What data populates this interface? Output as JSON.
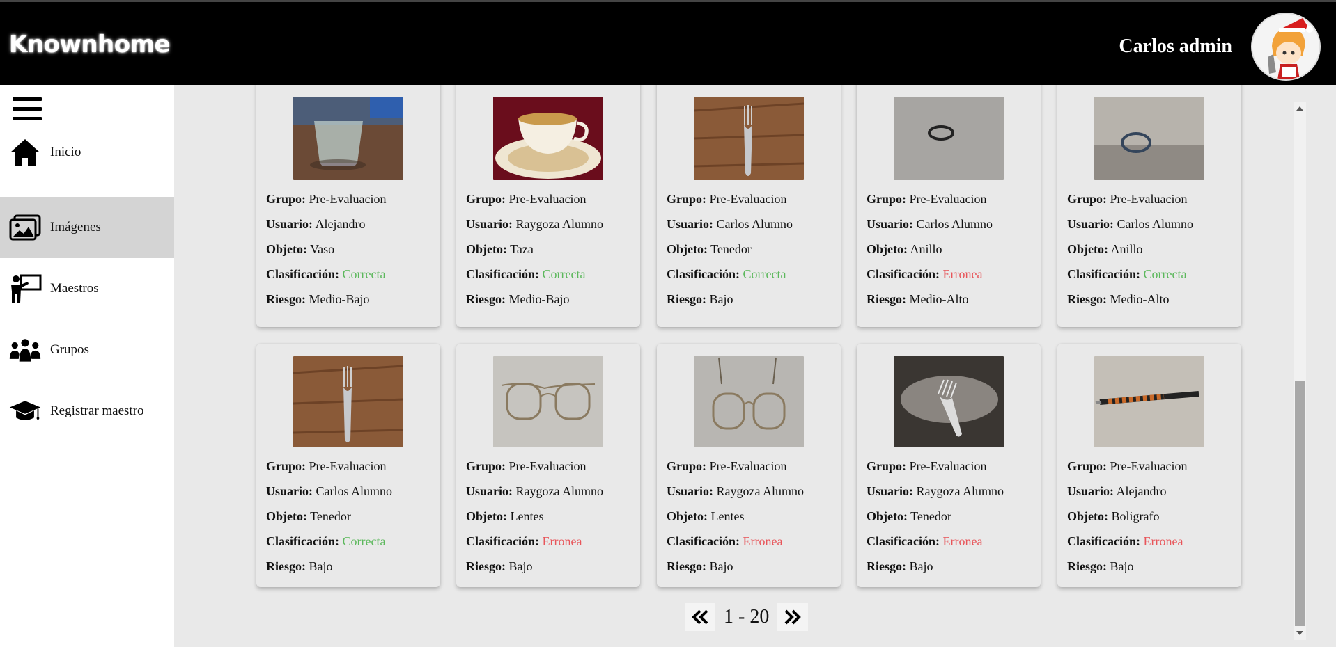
{
  "header": {
    "brand": "Knownhome",
    "user_name": "Carlos admin"
  },
  "sidebar": {
    "items": [
      {
        "label": "Inicio",
        "icon": "home-icon",
        "active": false
      },
      {
        "label": "Imágenes",
        "icon": "images-icon",
        "active": true
      },
      {
        "label": "Maestros",
        "icon": "teacher-icon",
        "active": false
      },
      {
        "label": "Grupos",
        "icon": "group-icon",
        "active": false
      },
      {
        "label": "Registrar maestro",
        "icon": "graduation-cap-icon",
        "active": false
      }
    ]
  },
  "labels": {
    "grupo": "Grupo:",
    "usuario": "Usuario:",
    "objeto": "Objeto:",
    "clasificacion": "Clasificación:",
    "riesgo": "Riesgo:"
  },
  "cards": [
    {
      "grupo": "Pre-Evaluacion",
      "usuario": "Alejandro",
      "objeto": "Vaso",
      "clasificacion": "Correcta",
      "riesgo": "Medio-Bajo",
      "image": "glass"
    },
    {
      "grupo": "Pre-Evaluacion",
      "usuario": "Raygoza Alumno",
      "objeto": "Taza",
      "clasificacion": "Correcta",
      "riesgo": "Medio-Bajo",
      "image": "teacup"
    },
    {
      "grupo": "Pre-Evaluacion",
      "usuario": "Carlos Alumno",
      "objeto": "Tenedor",
      "clasificacion": "Correcta",
      "riesgo": "Bajo",
      "image": "fork-wood"
    },
    {
      "grupo": "Pre-Evaluacion",
      "usuario": "Carlos Alumno",
      "objeto": "Anillo",
      "clasificacion": "Erronea",
      "riesgo": "Medio-Alto",
      "image": "ring-black"
    },
    {
      "grupo": "Pre-Evaluacion",
      "usuario": "Carlos Alumno",
      "objeto": "Anillo",
      "clasificacion": "Correcta",
      "riesgo": "Medio-Alto",
      "image": "ring-silver"
    },
    {
      "grupo": "Pre-Evaluacion",
      "usuario": "Carlos Alumno",
      "objeto": "Tenedor",
      "clasificacion": "Correcta",
      "riesgo": "Bajo",
      "image": "fork-wood"
    },
    {
      "grupo": "Pre-Evaluacion",
      "usuario": "Raygoza Alumno",
      "objeto": "Lentes",
      "clasificacion": "Erronea",
      "riesgo": "Bajo",
      "image": "glasses"
    },
    {
      "grupo": "Pre-Evaluacion",
      "usuario": "Raygoza Alumno",
      "objeto": "Lentes",
      "clasificacion": "Erronea",
      "riesgo": "Bajo",
      "image": "glasses-2"
    },
    {
      "grupo": "Pre-Evaluacion",
      "usuario": "Raygoza Alumno",
      "objeto": "Tenedor",
      "clasificacion": "Erronea",
      "riesgo": "Bajo",
      "image": "fork-dark"
    },
    {
      "grupo": "Pre-Evaluacion",
      "usuario": "Alejandro",
      "objeto": "Boligrafo",
      "clasificacion": "Erronea",
      "riesgo": "Bajo",
      "image": "pen"
    }
  ],
  "pagination": {
    "label": "1 - 20",
    "prev_icon": "double-chevron-left-icon",
    "next_icon": "double-chevron-right-icon"
  },
  "colors": {
    "correcta": "#5cb85c",
    "erronea": "#e8555a",
    "header_bg": "#000000",
    "active_nav": "#d4d4d4"
  }
}
